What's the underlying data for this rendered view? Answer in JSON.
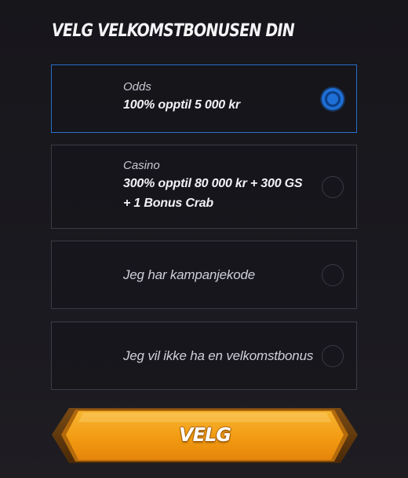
{
  "title": "VELG VELKOMSTBONUSEN DIN",
  "options": [
    {
      "label": "Odds",
      "value": "100% opptil 5 000 kr",
      "selected": true
    },
    {
      "label": "Casino",
      "value_line1": "300% opptil 80 000 kr + 300 GS",
      "value_line2": "+ 1 Bonus Crab",
      "selected": false
    },
    {
      "text": "Jeg har kampanjekode",
      "selected": false
    },
    {
      "text": "Jeg vil ikke ha en velkomstbonus",
      "selected": false
    }
  ],
  "cta_label": "VELG",
  "colors": {
    "background": "#17161b",
    "selected_border": "#2a6fc9",
    "radio_selected": "#1e6fd6",
    "button_orange": "#f4a21c",
    "button_edge": "#6a3f10"
  }
}
